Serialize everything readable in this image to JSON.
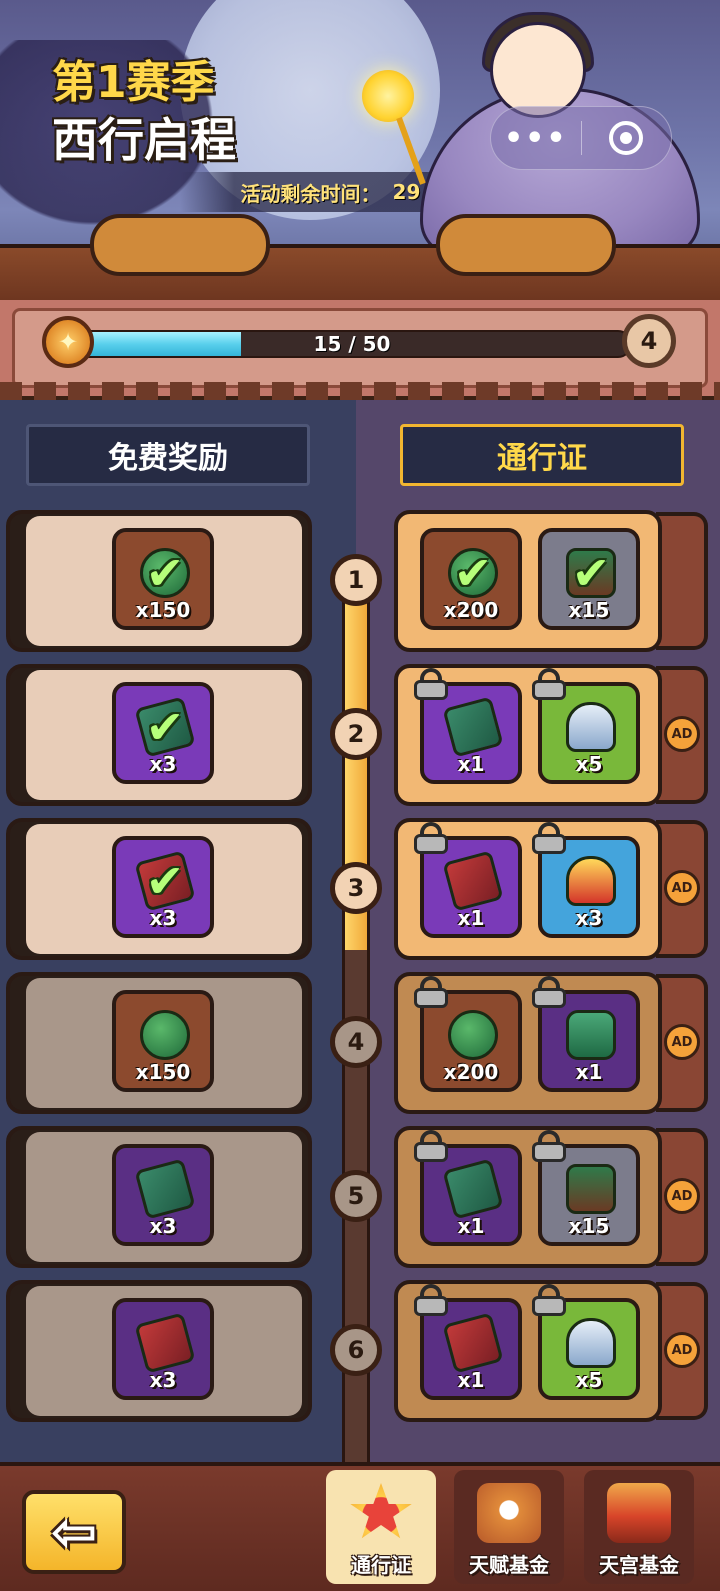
{
  "header": {
    "season_title": "第1赛季",
    "season_subtitle": "西行启程",
    "timer_label": "活动剩余时间：",
    "timer_value": "29 days",
    "more_icon": "more-dots-icon",
    "close_icon": "target-close-icon"
  },
  "progress": {
    "text": "15 / 50",
    "current": 15,
    "total": 50,
    "level": "4"
  },
  "tabs": {
    "free": "免费奖励",
    "pass": "通行证"
  },
  "rows": [
    {
      "level": "1",
      "state": "claimed",
      "free": {
        "qty": "x150",
        "icon": "jade-token-icon",
        "claimed": true
      },
      "pass": [
        {
          "qty": "x200",
          "icon": "jade-token-icon",
          "claimed": true
        },
        {
          "qty": "x15",
          "icon": "treasure-chest-icon",
          "claimed": true
        }
      ],
      "ad": false
    },
    {
      "level": "2",
      "state": "claimed",
      "free": {
        "qty": "x3",
        "icon": "green-scroll-icon",
        "claimed": true
      },
      "pass": [
        {
          "qty": "x1",
          "icon": "green-scroll-icon",
          "locked": true
        },
        {
          "qty": "x5",
          "icon": "silver-helmet-icon",
          "locked": true
        }
      ],
      "ad": true,
      "ad_label": "AD"
    },
    {
      "level": "3",
      "state": "claimed",
      "free": {
        "qty": "x3",
        "icon": "red-scroll-icon",
        "claimed": true
      },
      "pass": [
        {
          "qty": "x1",
          "icon": "red-scroll-icon",
          "locked": true
        },
        {
          "qty": "x3",
          "icon": "golden-helmet-icon",
          "locked": true
        }
      ],
      "ad": true,
      "ad_label": "AD"
    },
    {
      "level": "4",
      "state": "locked",
      "free": {
        "qty": "x150",
        "icon": "jade-token-icon"
      },
      "pass": [
        {
          "qty": "x200",
          "icon": "jade-token-icon",
          "locked": true
        },
        {
          "qty": "x1",
          "icon": "jade-armor-icon",
          "locked": true
        }
      ],
      "ad": true,
      "ad_label": "AD"
    },
    {
      "level": "5",
      "state": "locked",
      "free": {
        "qty": "x3",
        "icon": "green-scroll-icon"
      },
      "pass": [
        {
          "qty": "x1",
          "icon": "green-scroll-icon",
          "locked": true
        },
        {
          "qty": "x15",
          "icon": "treasure-chest-icon",
          "locked": true
        }
      ],
      "ad": true,
      "ad_label": "AD"
    },
    {
      "level": "6",
      "state": "locked",
      "free": {
        "qty": "x3",
        "icon": "red-scroll-icon"
      },
      "pass": [
        {
          "qty": "x1",
          "icon": "red-scroll-icon",
          "locked": true
        },
        {
          "qty": "x5",
          "icon": "silver-helmet-icon",
          "locked": true
        }
      ],
      "ad": true,
      "ad_label": "AD"
    }
  ],
  "bottom_nav": {
    "back_icon": "back-arrow-icon",
    "tabs": [
      {
        "label": "通行证",
        "icon": "star-badge-icon",
        "active": true
      },
      {
        "label": "天赋基金",
        "icon": "talent-fund-icon",
        "active": false
      },
      {
        "label": "天宫基金",
        "icon": "palace-fund-icon",
        "active": false
      }
    ]
  },
  "colors": {
    "accent_gold": "#ffd84a",
    "progress_blue": "#5ad0ec",
    "claimed_card": "#e8cdb8",
    "locked_card": "#a9978a"
  }
}
